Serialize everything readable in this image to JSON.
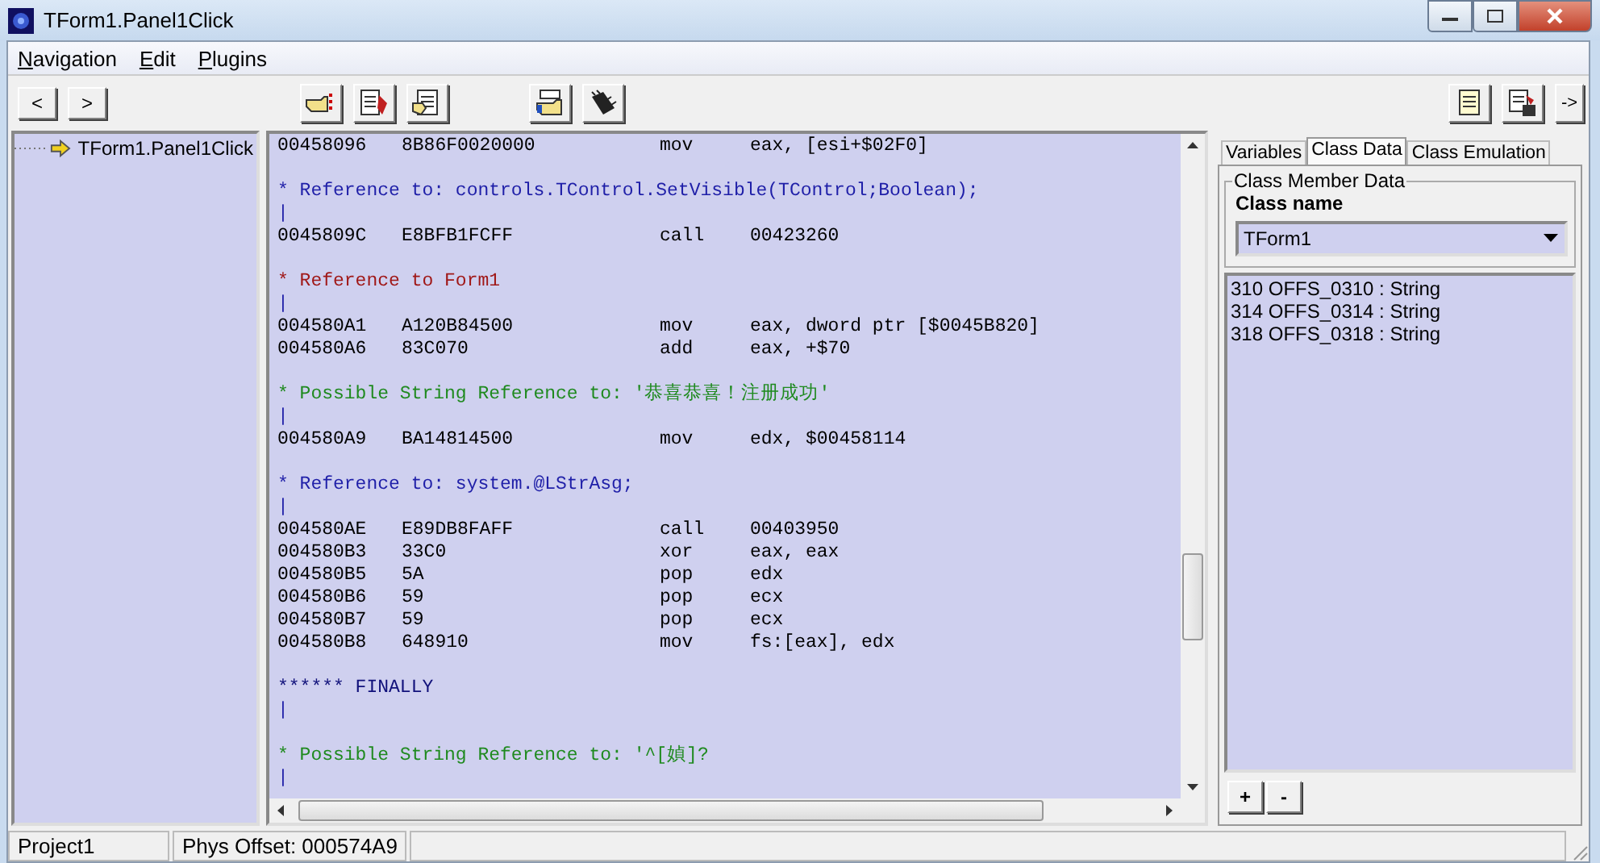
{
  "window": {
    "title": "TForm1.Panel1Click"
  },
  "menu": [
    {
      "label": "Navigation"
    },
    {
      "label": "Edit"
    },
    {
      "label": "Plugins"
    }
  ],
  "nav_buttons": [
    "<",
    ">"
  ],
  "right_toolbar": {
    "more_button": "->"
  },
  "tree": {
    "items": [
      {
        "label": "TForm1.Panel1Click",
        "selected": false
      }
    ]
  },
  "code": {
    "lines": [
      {
        "kind": "code",
        "address": "00458096",
        "bytes": "8B86F0020000",
        "op": "mov",
        "args": "eax, [esi+$02F0]"
      },
      {
        "kind": "blank"
      },
      {
        "kind": "ref",
        "text": "* Reference to: controls.TControl.SetVisible(TControl;Boolean);",
        "color": "#1f1fa8"
      },
      {
        "kind": "bar",
        "text": "|"
      },
      {
        "kind": "code",
        "address": "0045809C",
        "bytes": "E8BFB1FCFF",
        "op": "call",
        "args": "00423260"
      },
      {
        "kind": "blank"
      },
      {
        "kind": "ref",
        "text": "* Reference to Form1",
        "color": "#a01818"
      },
      {
        "kind": "bar",
        "text": "|"
      },
      {
        "kind": "code",
        "address": "004580A1",
        "bytes": "A120B84500",
        "op": "mov",
        "args": "eax, dword ptr [$0045B820]"
      },
      {
        "kind": "code",
        "address": "004580A6",
        "bytes": "83C070",
        "op": "add",
        "args": "eax, +$70"
      },
      {
        "kind": "blank"
      },
      {
        "kind": "ref",
        "text": "* Possible String Reference to: '恭喜恭喜！注册成功'",
        "color": "#1f8a1f"
      },
      {
        "kind": "bar",
        "text": "|"
      },
      {
        "kind": "code",
        "address": "004580A9",
        "bytes": "BA14814500",
        "op": "mov",
        "args": "edx, $00458114"
      },
      {
        "kind": "blank"
      },
      {
        "kind": "ref",
        "text": "* Reference to: system.@LStrAsg;",
        "color": "#1f1fa8"
      },
      {
        "kind": "bar",
        "text": "|"
      },
      {
        "kind": "code",
        "address": "004580AE",
        "bytes": "E89DB8FAFF",
        "op": "call",
        "args": "00403950"
      },
      {
        "kind": "code",
        "address": "004580B3",
        "bytes": "33C0",
        "op": "xor",
        "args": "eax, eax"
      },
      {
        "kind": "code",
        "address": "004580B5",
        "bytes": "5A",
        "op": "pop",
        "args": "edx"
      },
      {
        "kind": "code",
        "address": "004580B6",
        "bytes": "59",
        "op": "pop",
        "args": "ecx"
      },
      {
        "kind": "code",
        "address": "004580B7",
        "bytes": "59",
        "op": "pop",
        "args": "ecx"
      },
      {
        "kind": "code",
        "address": "004580B8",
        "bytes": "648910",
        "op": "mov",
        "args": "fs:[eax], edx"
      },
      {
        "kind": "blank"
      },
      {
        "kind": "ref",
        "text": "****** FINALLY",
        "color": "#10107a"
      },
      {
        "kind": "bar",
        "text": "|"
      },
      {
        "kind": "blank"
      },
      {
        "kind": "ref",
        "text": "* Possible String Reference to: '^[媜]?",
        "color": "#1f8a1f"
      },
      {
        "kind": "bar",
        "text": "|"
      }
    ]
  },
  "side_tabs": [
    {
      "label": "Variables",
      "selected": false
    },
    {
      "label": "Class Data",
      "selected": true
    },
    {
      "label": "Class Emulation",
      "selected": false
    }
  ],
  "class_member_data": {
    "title": "Class Member Data",
    "class_name_label": "Class name",
    "class_name": "TForm1",
    "members": [
      "310  OFFS_0310 : String",
      "314  OFFS_0314 : String",
      "318  OFFS_0318 : String"
    ],
    "buttons": [
      "+",
      "-"
    ]
  },
  "status_bar": [
    "Project1",
    "Phys Offset: 000574A9"
  ]
}
